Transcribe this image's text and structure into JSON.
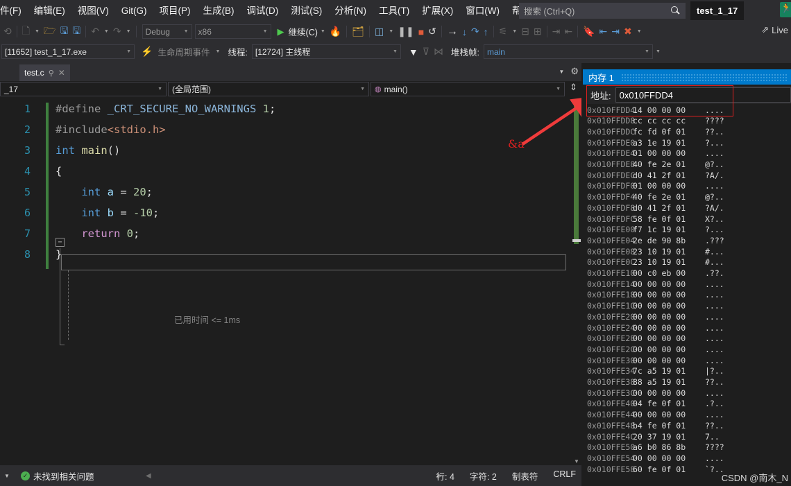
{
  "menu": {
    "items": [
      {
        "label": "件(F)",
        "name": "menu-file"
      },
      {
        "label": "编辑(E)",
        "name": "menu-edit"
      },
      {
        "label": "视图(V)",
        "name": "menu-view"
      },
      {
        "label": "Git(G)",
        "name": "menu-git"
      },
      {
        "label": "项目(P)",
        "name": "menu-project"
      },
      {
        "label": "生成(B)",
        "name": "menu-build"
      },
      {
        "label": "调试(D)",
        "name": "menu-debug"
      },
      {
        "label": "测试(S)",
        "name": "menu-test"
      },
      {
        "label": "分析(N)",
        "name": "menu-analyze"
      },
      {
        "label": "工具(T)",
        "name": "menu-tools"
      },
      {
        "label": "扩展(X)",
        "name": "menu-extensions"
      },
      {
        "label": "窗口(W)",
        "name": "menu-window"
      },
      {
        "label": "帮助(H)",
        "name": "menu-help"
      }
    ],
    "search_placeholder": "搜索 (Ctrl+Q)",
    "project_chip": "test_1_17",
    "search_icon": "search-icon",
    "run_icon": "run-person-icon"
  },
  "toolbar": {
    "config": "Debug",
    "platform": "x86",
    "continue_label": "继续(C)",
    "live_share_label": "Live",
    "live_share_icon": "share-icon",
    "icons": [
      "back-navigate-icon",
      "new-item-icon",
      "open-file-icon",
      "save-icon",
      "save-all-icon",
      "undo-icon",
      "redo-icon",
      "start-debug-icon",
      "hot-reload-icon",
      "attach-icon",
      "breakpoint-window-icon",
      "pause-icon",
      "stop-icon",
      "restart-icon",
      "show-next-statement-icon",
      "step-into-icon",
      "step-over-icon",
      "step-out-icon",
      "diagnostics-icon",
      "comment-icon",
      "uncomment-icon",
      "decrease-indent-icon",
      "increase-indent-icon",
      "bookmark-icon",
      "prev-bookmark-icon",
      "next-bookmark-icon",
      "clear-bookmarks-icon"
    ]
  },
  "debugbar": {
    "process": "[11652] test_1_17.exe",
    "lifecycle_events": "生命周期事件",
    "thread_label": "线程:",
    "thread": "[12724] 主线程",
    "stackframe_label": "堆栈帧:",
    "stackframe": "main",
    "lifecycle_icon": "lifecycle-icon",
    "filter_icon": "filter-icon",
    "filter2_icon": "filter-threads-icon",
    "shuffle_icon": "parallel-stacks-icon"
  },
  "editor": {
    "tab": {
      "label": "test.c",
      "pin_icon": "pin-icon",
      "close_icon": "close-icon"
    },
    "nav": {
      "file_scope": "_17",
      "member_scope": "(全局范围)",
      "function_scope": "main()",
      "function_icon": "method-icon",
      "split_icon": "split-view-icon",
      "dropdown_icon": "chevron-down-icon",
      "settings_icon": "gear-icon"
    },
    "lines": [
      {
        "num": "1",
        "segments": [
          {
            "t": "#define ",
            "c": "k-pre"
          },
          {
            "t": "_CRT_SECURE_NO_WARNINGS ",
            "c": "k-macro"
          },
          {
            "t": "1",
            "c": "k-num"
          },
          {
            "t": ";",
            "c": "k-op"
          }
        ]
      },
      {
        "num": "2",
        "segments": [
          {
            "t": "#include",
            "c": "k-pre"
          },
          {
            "t": "<stdio.h>",
            "c": "k-hdr"
          }
        ]
      },
      {
        "num": "3",
        "segments": [
          {
            "t": "int ",
            "c": "k-type"
          },
          {
            "t": "main",
            "c": "k-fn"
          },
          {
            "t": "()",
            "c": "k-op"
          }
        ]
      },
      {
        "num": "4",
        "segments": [
          {
            "t": "{",
            "c": "k-brace"
          }
        ]
      },
      {
        "num": "5",
        "segments": [
          {
            "t": "    int ",
            "c": "k-type"
          },
          {
            "t": "a",
            "c": "k-ident"
          },
          {
            "t": " = ",
            "c": "k-op"
          },
          {
            "t": "20",
            "c": "k-num"
          },
          {
            "t": ";",
            "c": "k-op"
          }
        ]
      },
      {
        "num": "6",
        "segments": [
          {
            "t": "    int ",
            "c": "k-type"
          },
          {
            "t": "b",
            "c": "k-ident"
          },
          {
            "t": " = ",
            "c": "k-op"
          },
          {
            "t": "-10",
            "c": "k-num"
          },
          {
            "t": ";",
            "c": "k-op"
          }
        ]
      },
      {
        "num": "7",
        "segments": [
          {
            "t": "    return ",
            "c": "k-ret"
          },
          {
            "t": "0",
            "c": "k-num"
          },
          {
            "t": ";",
            "c": "k-op"
          }
        ]
      },
      {
        "num": "8",
        "segments": [
          {
            "t": "}",
            "c": "k-brace"
          }
        ]
      }
    ],
    "elapsed_time": "已用时间 <= 1ms",
    "collapse_glyph": "−",
    "scrollbar": {
      "up_icon": "scroll-up-icon",
      "down_icon": "scroll-down-icon"
    }
  },
  "annotation": {
    "label": "&a",
    "color": "#e02020",
    "arrow_name": "red-arrow-annotation"
  },
  "memory": {
    "title": "内存 1",
    "address_label": "地址:",
    "address_value": "0x010FFDD4",
    "watermark": "CSDN @南木_N",
    "rows": [
      {
        "addr": "0x010FFDD4",
        "hex": "14 00 00 00",
        "ascii": "...."
      },
      {
        "addr": "0x010FFDD8",
        "hex": "cc cc cc cc",
        "ascii": "????"
      },
      {
        "addr": "0x010FFDDC",
        "hex": "fc fd 0f 01",
        "ascii": "??.."
      },
      {
        "addr": "0x010FFDE0",
        "hex": "a3 1e 19 01",
        "ascii": "?..."
      },
      {
        "addr": "0x010FFDE4",
        "hex": "01 00 00 00",
        "ascii": "...."
      },
      {
        "addr": "0x010FFDE8",
        "hex": "40 fe 2e 01",
        "ascii": "@?.."
      },
      {
        "addr": "0x010FFDEC",
        "hex": "d0 41 2f 01",
        "ascii": "?A/."
      },
      {
        "addr": "0x010FFDF0",
        "hex": "01 00 00 00",
        "ascii": "...."
      },
      {
        "addr": "0x010FFDF4",
        "hex": "40 fe 2e 01",
        "ascii": "@?.."
      },
      {
        "addr": "0x010FFDF8",
        "hex": "d0 41 2f 01",
        "ascii": "?A/."
      },
      {
        "addr": "0x010FFDFC",
        "hex": "58 fe 0f 01",
        "ascii": "X?.."
      },
      {
        "addr": "0x010FFE00",
        "hex": "f7 1c 19 01",
        "ascii": "?..."
      },
      {
        "addr": "0x010FFE04",
        "hex": "2e de 90 8b",
        "ascii": ".???"
      },
      {
        "addr": "0x010FFE08",
        "hex": "23 10 19 01",
        "ascii": "#..."
      },
      {
        "addr": "0x010FFE0C",
        "hex": "23 10 19 01",
        "ascii": "#..."
      },
      {
        "addr": "0x010FFE10",
        "hex": "00 c0 eb 00",
        "ascii": ".??."
      },
      {
        "addr": "0x010FFE14",
        "hex": "00 00 00 00",
        "ascii": "...."
      },
      {
        "addr": "0x010FFE18",
        "hex": "00 00 00 00",
        "ascii": "...."
      },
      {
        "addr": "0x010FFE1C",
        "hex": "00 00 00 00",
        "ascii": "...."
      },
      {
        "addr": "0x010FFE20",
        "hex": "00 00 00 00",
        "ascii": "...."
      },
      {
        "addr": "0x010FFE24",
        "hex": "00 00 00 00",
        "ascii": "...."
      },
      {
        "addr": "0x010FFE28",
        "hex": "00 00 00 00",
        "ascii": "...."
      },
      {
        "addr": "0x010FFE2C",
        "hex": "00 00 00 00",
        "ascii": "...."
      },
      {
        "addr": "0x010FFE30",
        "hex": "00 00 00 00",
        "ascii": "...."
      },
      {
        "addr": "0x010FFE34",
        "hex": "7c a5 19 01",
        "ascii": "|?.."
      },
      {
        "addr": "0x010FFE38",
        "hex": "88 a5 19 01",
        "ascii": "??.."
      },
      {
        "addr": "0x010FFE3C",
        "hex": "00 00 00 00",
        "ascii": "...."
      },
      {
        "addr": "0x010FFE40",
        "hex": "04 fe 0f 01",
        "ascii": ".?.."
      },
      {
        "addr": "0x010FFE44",
        "hex": "00 00 00 00",
        "ascii": "...."
      },
      {
        "addr": "0x010FFE48",
        "hex": "b4 fe 0f 01",
        "ascii": "??.."
      },
      {
        "addr": "0x010FFE4C",
        "hex": "20 37 19 01",
        "ascii": " 7.."
      },
      {
        "addr": "0x010FFE50",
        "hex": "a6 b0 86 8b",
        "ascii": "????"
      },
      {
        "addr": "0x010FFE54",
        "hex": "00 00 00 00",
        "ascii": "...."
      },
      {
        "addr": "0x010FFE58",
        "hex": "60 fe 0f 01",
        "ascii": "`?.."
      }
    ]
  },
  "statusbar": {
    "problems": "未找到相关问题",
    "problems_icon": "check-circle-icon",
    "line": "行: 4",
    "column": "字符: 2",
    "tabs": "制表符",
    "eol": "CRLF",
    "scroll_left_icon": "scroll-left-icon",
    "scroll_right_icon": "scroll-right-icon"
  }
}
